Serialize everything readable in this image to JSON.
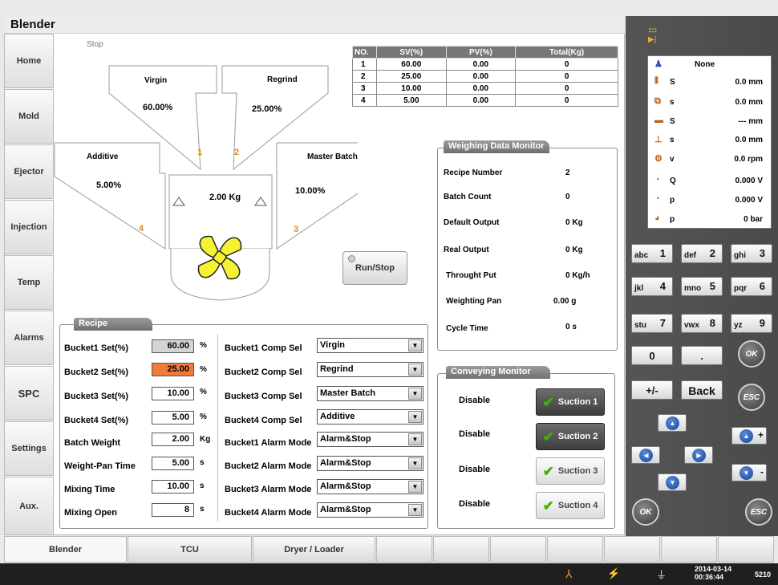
{
  "app": {
    "title": "Blender",
    "status": "Stop"
  },
  "nav": [
    {
      "label": "Home"
    },
    {
      "label": "Mold"
    },
    {
      "label": "Ejector"
    },
    {
      "label": "Injection"
    },
    {
      "label": "Temp"
    },
    {
      "label": "Alarms"
    },
    {
      "label": "SPC"
    },
    {
      "label": "Settings"
    },
    {
      "label": "Aux."
    }
  ],
  "hoppers": [
    {
      "name": "Virgin",
      "pct": "60.00%",
      "index": "1"
    },
    {
      "name": "Regrind",
      "pct": "25.00%",
      "index": "2"
    },
    {
      "name": "Additive",
      "pct": "5.00%",
      "index": "4"
    },
    {
      "name": "Master Batch",
      "pct": "10.00%",
      "index": "3"
    }
  ],
  "weight": "2.00 Kg",
  "table": {
    "headers": [
      "NO.",
      "SV(%)",
      "PV(%)",
      "Total(Kg)"
    ],
    "rows": [
      [
        "1",
        "60.00",
        "0.00",
        "0"
      ],
      [
        "2",
        "25.00",
        "0.00",
        "0"
      ],
      [
        "3",
        "10.00",
        "0.00",
        "0"
      ],
      [
        "4",
        "5.00",
        "0.00",
        "0"
      ]
    ]
  },
  "run_button": "Run/Stop",
  "weighing": {
    "title": "Weighing Data Monitor",
    "rows": [
      {
        "label": "Recipe Number",
        "value": "2"
      },
      {
        "label": "Batch Count",
        "value": "0"
      },
      {
        "label": "Default Output",
        "value": "0 Kg"
      },
      {
        "label": "Real Output",
        "value": "0 Kg"
      },
      {
        "label": "Throught Put",
        "value": "0 Kg/h"
      },
      {
        "label": "Weighting Pan",
        "value": "0.00 g"
      },
      {
        "label": "Cycle Time",
        "value": "0 s"
      }
    ]
  },
  "conveying": {
    "title": "Conveying Monitor",
    "rows": [
      {
        "status": "Disable",
        "button": "Suction 1",
        "active": true
      },
      {
        "status": "Disable",
        "button": "Suction 2",
        "active": true
      },
      {
        "status": "Disable",
        "button": "Suction 3",
        "active": false
      },
      {
        "status": "Disable",
        "button": "Suction 4",
        "active": false
      }
    ]
  },
  "recipe": {
    "title": "Recipe",
    "params": [
      {
        "label": "Bucket1 Set(%)",
        "value": "60.00",
        "unit": "%"
      },
      {
        "label": "Bucket2 Set(%)",
        "value": "25.00",
        "unit": "%"
      },
      {
        "label": "Bucket3 Set(%)",
        "value": "10.00",
        "unit": "%"
      },
      {
        "label": "Bucket4 Set(%)",
        "value": "5.00",
        "unit": "%"
      },
      {
        "label": "Batch Weight",
        "value": "2.00",
        "unit": "Kg"
      },
      {
        "label": "Weight-Pan Time",
        "value": "5.00",
        "unit": "s"
      },
      {
        "label": "Mixing Time",
        "value": "10.00",
        "unit": "s"
      },
      {
        "label": "Mixing Open",
        "value": "8",
        "unit": "s"
      }
    ],
    "selects": [
      {
        "label": "Bucket1 Comp Sel",
        "value": "Virgin"
      },
      {
        "label": "Bucket2 Comp Sel",
        "value": "Regrind"
      },
      {
        "label": "Bucket3 Comp Sel",
        "value": "Master Batch"
      },
      {
        "label": "Bucket4 Comp Sel",
        "value": "Additive"
      },
      {
        "label": "Bucket1 Alarm Mode",
        "value": "Alarm&Stop"
      },
      {
        "label": "Bucket2 Alarm Mode",
        "value": "Alarm&Stop"
      },
      {
        "label": "Bucket3 Alarm Mode",
        "value": "Alarm&Stop"
      },
      {
        "label": "Bucket4 Alarm Mode",
        "value": "Alarm&Stop"
      }
    ]
  },
  "bottom_tabs": [
    {
      "label": "Blender"
    },
    {
      "label": "TCU"
    },
    {
      "label": "Dryer / Loader"
    }
  ],
  "status_panel": {
    "user": "None",
    "rows": [
      {
        "var": "S",
        "value": "0.0",
        "unit": "mm"
      },
      {
        "var": "s",
        "value": "0.0",
        "unit": "mm"
      },
      {
        "var": "S",
        "value": "---",
        "unit": "mm"
      },
      {
        "var": "s",
        "value": "0.0",
        "unit": "mm"
      },
      {
        "var": "v",
        "value": "0.0",
        "unit": "rpm"
      },
      {
        "var": "Q",
        "value": "0.000",
        "unit": "V"
      },
      {
        "var": "p",
        "value": "0.000",
        "unit": "V"
      },
      {
        "var": "p",
        "value": "0",
        "unit": "bar"
      }
    ]
  },
  "keypad": {
    "keys": [
      {
        "small": "abc",
        "big": "1"
      },
      {
        "small": "def",
        "big": "2"
      },
      {
        "small": "ghi",
        "big": "3"
      },
      {
        "small": "jkl",
        "big": "4"
      },
      {
        "small": "mno",
        "big": "5"
      },
      {
        "small": "pqr",
        "big": "6"
      },
      {
        "small": "stu",
        "big": "7"
      },
      {
        "small": "vwx",
        "big": "8"
      },
      {
        "small": "yz",
        "big": "9"
      }
    ],
    "zero": "0",
    "dot": ".",
    "plusminus": "+/-",
    "back": "Back",
    "ok": "OK",
    "esc": "ESC",
    "plus": "+",
    "minus": "-"
  },
  "clock": {
    "date": "2014-03-14",
    "time": "00:36:44"
  },
  "build": "5210",
  "colors": {
    "highlight_input": "#f07a3a",
    "hopper_index": "#e08a1a",
    "check": "#3cb400"
  }
}
